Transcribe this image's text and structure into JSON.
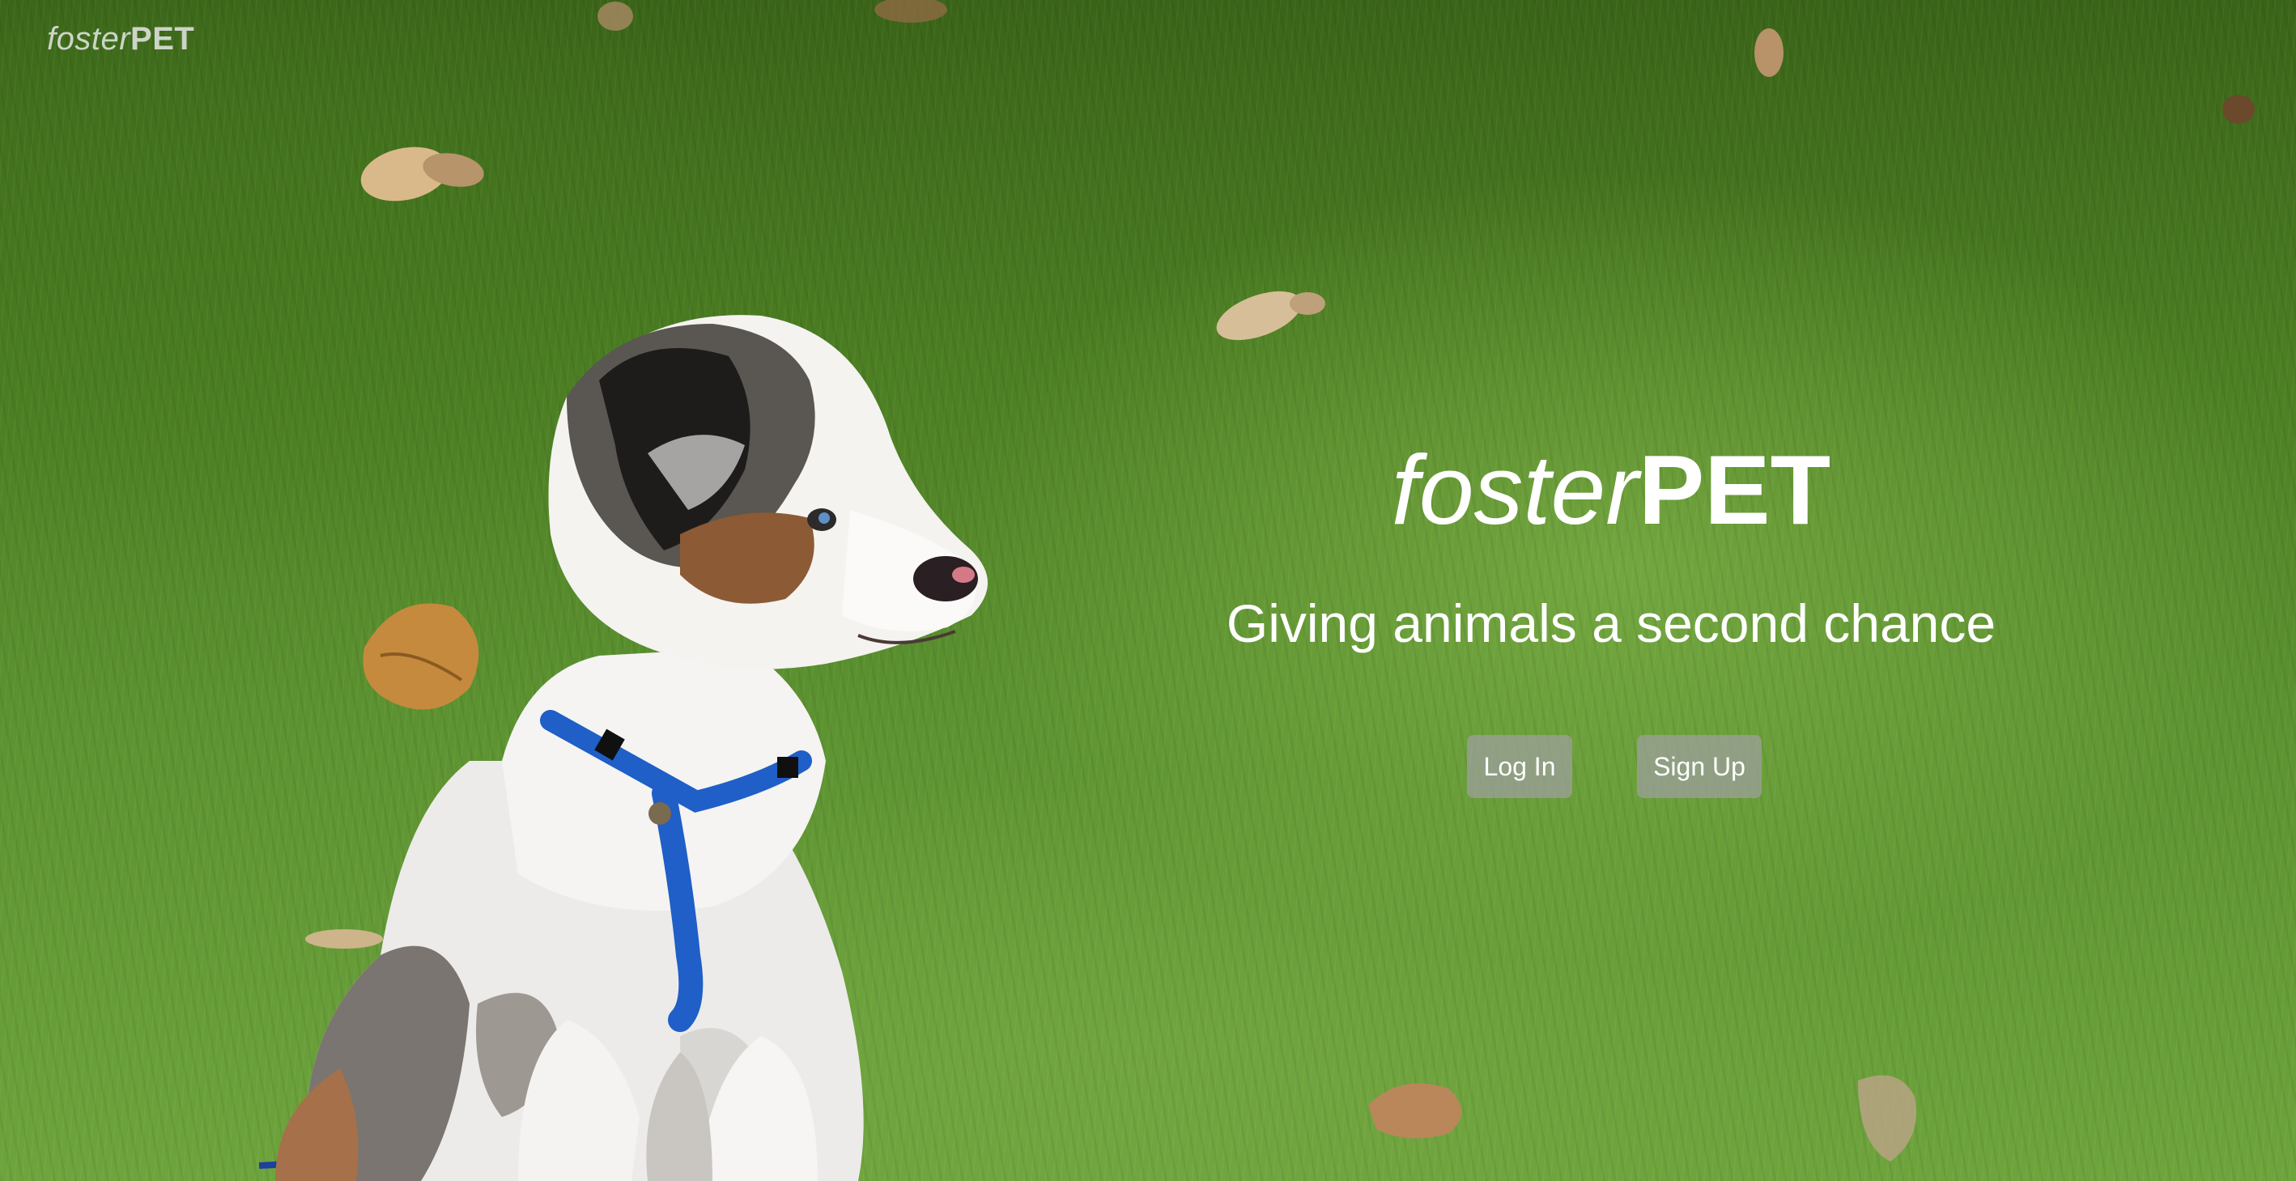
{
  "nav": {
    "brand_italic": "foster",
    "brand_bold": "PET"
  },
  "hero": {
    "brand_italic": "foster",
    "brand_bold": "PET",
    "tagline": "Giving animals a second chance",
    "login_label": "Log In",
    "signup_label": "Sign Up"
  },
  "colors": {
    "grass": "#4b7d22",
    "button_bg": "#a0a0a0",
    "text": "#ffffff",
    "harness": "#1f5fc7"
  }
}
